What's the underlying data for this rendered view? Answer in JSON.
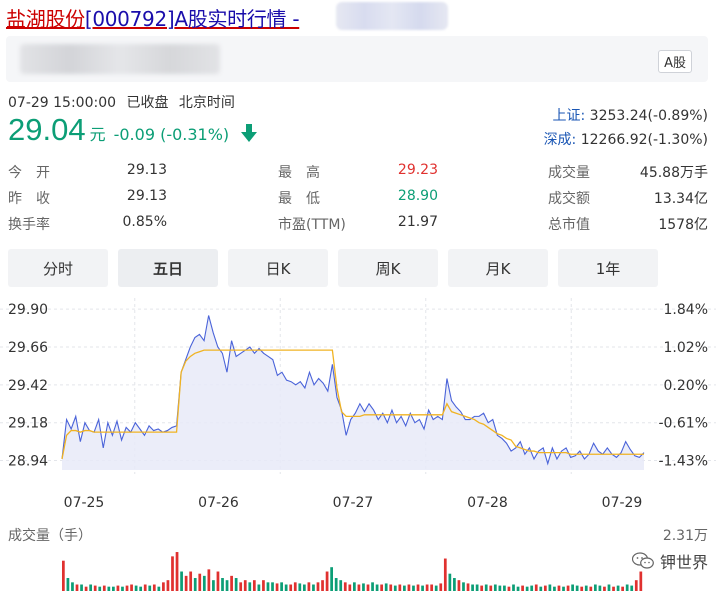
{
  "title": {
    "name": "盐湖股份",
    "code": "[000792]",
    "rest": "A股实时行情 - "
  },
  "badge": "A股",
  "status": {
    "timestamp": "07-29 15:00:00",
    "state": "已收盘",
    "tz": "北京时间"
  },
  "price": {
    "last": "29.04",
    "unit": "元",
    "change": "-0.09 (-0.31%)"
  },
  "indices": [
    {
      "label": "上证:",
      "value": "3253.24(-0.89%)"
    },
    {
      "label": "深成:",
      "value": "12266.92(-1.30%)"
    }
  ],
  "stats": [
    [
      {
        "label": "今　开",
        "value": "29.13",
        "color": "#333333"
      },
      {
        "label": "最　高",
        "value": "29.23",
        "color": "#e0312f"
      },
      {
        "label": "成交量",
        "value": "45.88万手",
        "color": "#333333"
      }
    ],
    [
      {
        "label": "昨　收",
        "value": "29.13",
        "color": "#333333"
      },
      {
        "label": "最　低",
        "value": "28.90",
        "color": "#0c9e76"
      },
      {
        "label": "成交额",
        "value": "13.34亿",
        "color": "#333333"
      }
    ],
    [
      {
        "label": "换手率",
        "value": "0.85%",
        "color": "#333333"
      },
      {
        "label": "市盈(TTM)",
        "value": "21.97",
        "color": "#333333"
      },
      {
        "label": "总市值",
        "value": "1578亿",
        "color": "#333333"
      }
    ]
  ],
  "tabs": [
    {
      "label": "分时",
      "active": false
    },
    {
      "label": "五日",
      "active": true
    },
    {
      "label": "日K",
      "active": false
    },
    {
      "label": "周K",
      "active": false
    },
    {
      "label": "月K",
      "active": false
    },
    {
      "label": "1年",
      "active": false
    }
  ],
  "chart_data": {
    "type": "line",
    "y_ticks": [
      "29.90",
      "29.66",
      "29.42",
      "29.18",
      "28.94"
    ],
    "y_right_ticks": [
      "1.84%",
      "1.02%",
      "0.20%",
      "-0.61%",
      "-1.43%"
    ],
    "x_ticks": [
      "07-25",
      "07-26",
      "07-27",
      "07-28",
      "07-29"
    ],
    "ylim": [
      28.88,
      29.92
    ],
    "colors": {
      "price": "#4a63d9",
      "avg": "#f0b323",
      "fill": "#e7eaf8",
      "up": "#e0312f",
      "down": "#0c9e76"
    },
    "series": [
      {
        "values": [
          28.95,
          29.2,
          29.14,
          29.22,
          29.06,
          29.18,
          29.13,
          29.12,
          29.2,
          29.02,
          29.18,
          29.1,
          29.19,
          29.07,
          29.15,
          29.12,
          29.18,
          29.14,
          29.1,
          29.16,
          29.13,
          29.14,
          29.12,
          29.13,
          29.15,
          29.16,
          29.5,
          29.58,
          29.66,
          29.72,
          29.74,
          29.7,
          29.86,
          29.75,
          29.66,
          29.62,
          29.5,
          29.7,
          29.6,
          29.62,
          29.64,
          29.66,
          29.62,
          29.65,
          29.62,
          29.6,
          29.58,
          29.48,
          29.5,
          29.45,
          29.44,
          29.42,
          29.44,
          29.4,
          29.5,
          29.42,
          29.46,
          29.43,
          29.38,
          29.55,
          29.34,
          29.26,
          29.1,
          29.2,
          29.24,
          29.3,
          29.25,
          29.3,
          29.26,
          29.2,
          29.24,
          29.18,
          29.26,
          29.18,
          29.22,
          29.16,
          29.24,
          29.18,
          29.2,
          29.14,
          29.26,
          29.2,
          29.22,
          29.2,
          29.46,
          29.32,
          29.28,
          29.25,
          29.2,
          29.2,
          29.22,
          29.22,
          29.24,
          29.18,
          29.2,
          29.1,
          29.08,
          29.05,
          29.0,
          29.02,
          29.06,
          28.98,
          29.02,
          28.95,
          29.0,
          29.02,
          28.92,
          29.02,
          28.95,
          29.0,
          29.02,
          28.96,
          28.97,
          29.0,
          28.95,
          28.98,
          29.05,
          29.0,
          28.98,
          29.02,
          28.98,
          28.96,
          28.99,
          29.06,
          29.01,
          28.97,
          28.96,
          28.99
        ]
      },
      {
        "values": [
          28.95,
          29.1,
          29.13,
          29.13,
          29.12,
          29.13,
          29.13,
          29.12,
          29.12,
          29.12,
          29.12,
          29.12,
          29.12,
          29.12,
          29.12,
          29.12,
          29.12,
          29.12,
          29.12,
          29.12,
          29.12,
          29.12,
          29.12,
          29.12,
          29.12,
          29.12,
          29.5,
          29.57,
          29.6,
          29.62,
          29.63,
          29.64,
          29.64,
          29.64,
          29.64,
          29.64,
          29.64,
          29.64,
          29.64,
          29.64,
          29.64,
          29.64,
          29.64,
          29.64,
          29.64,
          29.64,
          29.64,
          29.64,
          29.64,
          29.64,
          29.64,
          29.64,
          29.64,
          29.64,
          29.64,
          29.64,
          29.64,
          29.64,
          29.64,
          29.64,
          29.4,
          29.25,
          29.22,
          29.22,
          29.22,
          29.22,
          29.23,
          29.23,
          29.23,
          29.23,
          29.23,
          29.23,
          29.23,
          29.23,
          29.23,
          29.23,
          29.23,
          29.23,
          29.23,
          29.23,
          29.23,
          29.23,
          29.23,
          29.23,
          29.3,
          29.25,
          29.24,
          29.23,
          29.22,
          29.21,
          29.2,
          29.18,
          29.17,
          29.15,
          29.13,
          29.11,
          29.1,
          29.08,
          29.07,
          29.03,
          29.02,
          29.01,
          29.0,
          29.0,
          28.99,
          28.99,
          28.99,
          28.99,
          28.99,
          28.99,
          28.99,
          28.98,
          28.98,
          28.98,
          28.98,
          28.98,
          28.98,
          28.98,
          28.98,
          28.98,
          28.98,
          28.98,
          28.98,
          28.98,
          28.98,
          28.98,
          28.98,
          28.98
        ]
      }
    ]
  },
  "volume": {
    "label": "成交量（手）",
    "max_label": "2.31万",
    "max": 23100,
    "values": [
      14000,
      6000,
      4000,
      3000,
      3000,
      2000,
      3000,
      2500,
      2000,
      2500,
      2000,
      2000,
      2500,
      2000,
      2500,
      3000,
      2500,
      2000,
      3000,
      2500,
      3000,
      2000,
      4000,
      5000,
      16000,
      18000,
      9000,
      7000,
      9000,
      6000,
      8000,
      7000,
      10000,
      5000,
      9000,
      6000,
      5000,
      7000,
      6000,
      4000,
      5000,
      4000,
      5000,
      3000,
      5000,
      4000,
      4000,
      3500,
      4000,
      3000,
      3000,
      4000,
      3500,
      3000,
      4000,
      3000,
      4000,
      5000,
      9000,
      11000,
      6000,
      5000,
      4000,
      3000,
      4000,
      3000,
      3500,
      3000,
      4000,
      3000,
      3000,
      3500,
      3000,
      2500,
      3000,
      2500,
      3000,
      2500,
      3000,
      2500,
      3000,
      3000,
      2500,
      3500,
      15000,
      8000,
      6000,
      5000,
      4000,
      3500,
      3000,
      3000,
      2500,
      3000,
      2500,
      3000,
      2500,
      2500,
      2000,
      3000,
      2000,
      2500,
      2000,
      2500,
      3000,
      2000,
      2500,
      3000,
      2000,
      2500,
      2000,
      2500,
      3000,
      2500,
      2000,
      2500,
      2000,
      3000,
      2500,
      2000,
      3000,
      2000,
      2500,
      2000,
      3000,
      2500,
      5000,
      9000
    ],
    "up": [
      1,
      0,
      0,
      1,
      0,
      1,
      0,
      1,
      0,
      1,
      0,
      0,
      1,
      0,
      1,
      1,
      0,
      0,
      1,
      0,
      1,
      0,
      1,
      1,
      1,
      1,
      0,
      1,
      1,
      0,
      1,
      0,
      1,
      0,
      1,
      0,
      0,
      1,
      0,
      1,
      1,
      0,
      1,
      0,
      1,
      0,
      0,
      1,
      0,
      0,
      1,
      1,
      0,
      0,
      1,
      0,
      1,
      1,
      1,
      0,
      0,
      0,
      1,
      1,
      0,
      1,
      0,
      1,
      0,
      0,
      1,
      0,
      1,
      0,
      1,
      0,
      1,
      0,
      1,
      0,
      1,
      1,
      0,
      1,
      1,
      0,
      0,
      1,
      0,
      1,
      0,
      0,
      1,
      0,
      1,
      0,
      0,
      0,
      1,
      0,
      0,
      1,
      0,
      0,
      1,
      0,
      1,
      0,
      0,
      1,
      0,
      1,
      0,
      0,
      1,
      0,
      1,
      0,
      0,
      1,
      0,
      1,
      0,
      1,
      0,
      0,
      1,
      1
    ]
  },
  "watermark": "钾世界"
}
